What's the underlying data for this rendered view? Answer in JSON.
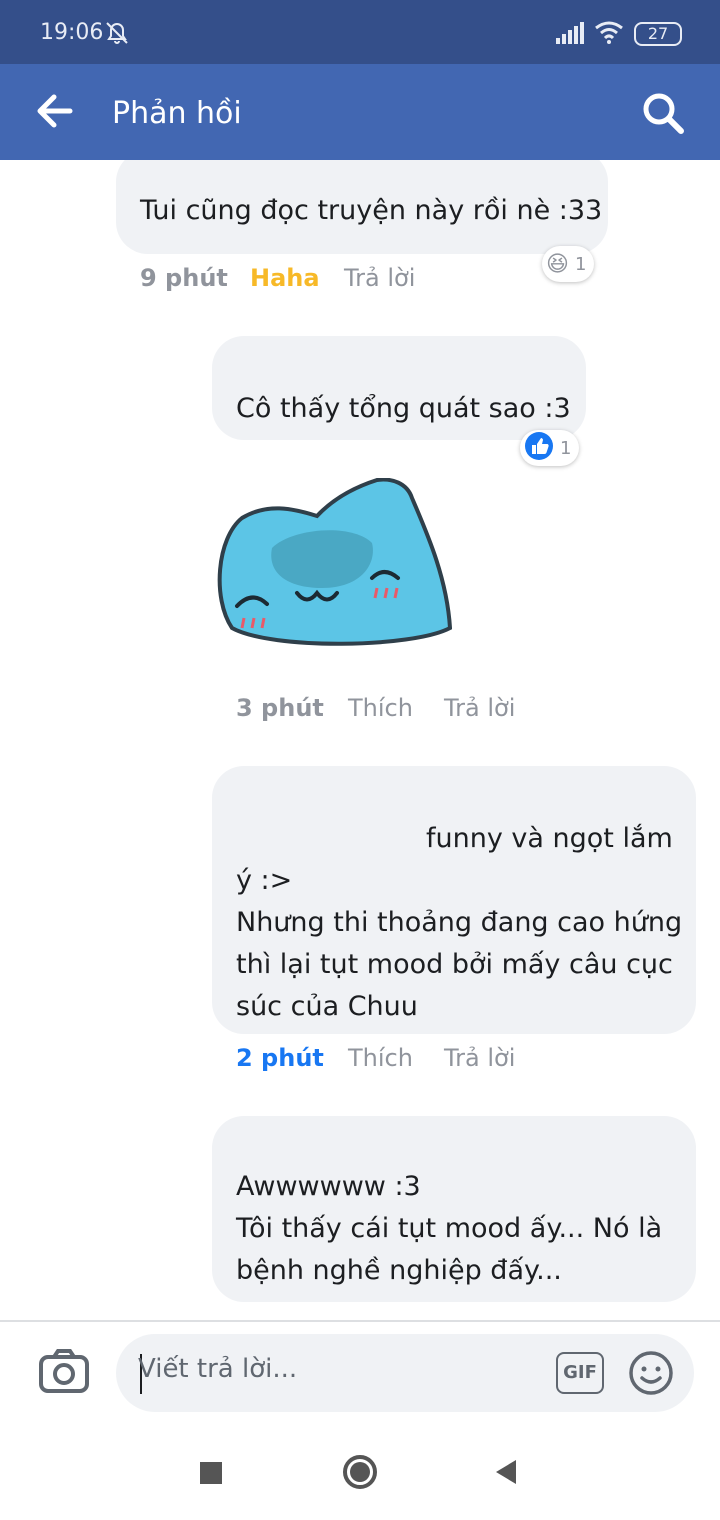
{
  "status_bar": {
    "time": "19:06",
    "battery": "27"
  },
  "app_bar": {
    "title": "Phản hồi"
  },
  "comments": [
    {
      "text": "Tui cũng đọc truyện này rồi nè :33",
      "time": "9 phút",
      "reaction_label": "Haha",
      "reply_label": "Trả lời",
      "reaction_emoji": "😆",
      "reaction_count": "1",
      "reaction_color": "#f7b928"
    },
    {
      "text": "Cô thấy tổng quát sao :3",
      "reaction_emoji": "👍",
      "reaction_count": "1",
      "has_sticker": true,
      "sticker": "blue-cat-sticker",
      "time": "3 phút",
      "reaction_label": "Thích",
      "reply_label": "Trả lời"
    },
    {
      "text_line1": "funny và ngọt lắm",
      "text_rest": "ý :>\nNhưng thi thoảng đang cao hứng\nthì lại tụt mood bởi mấy câu cục\nsúc của Chuu",
      "time": "2 phút",
      "time_color": "#1877f2",
      "reaction_label": "Thích",
      "reply_label": "Trả lời"
    },
    {
      "text": "Awwwwww :3\nTôi thấy cái tụt mood ấy... Nó là\nbệnh nghề nghiệp đấy..."
    }
  ],
  "composer": {
    "placeholder": "Viết trả lời...",
    "gif_label": "GIF"
  }
}
